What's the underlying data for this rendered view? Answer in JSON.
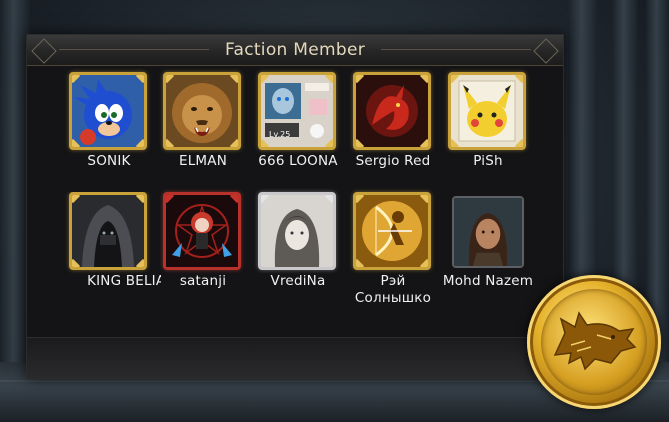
{
  "panel": {
    "title": "Faction Member"
  },
  "members": [
    {
      "name": "SONIK",
      "frame": "gold",
      "art": "sonic-icon"
    },
    {
      "name": "ELMAN",
      "frame": "gold",
      "art": "lion-icon"
    },
    {
      "name": "666 LOONA",
      "frame": "gold",
      "art": "white-walker-icon",
      "level": "Lv.25"
    },
    {
      "name": "Sergio Red",
      "frame": "gold",
      "art": "red-dragon-icon"
    },
    {
      "name": "PiSh",
      "frame": "gold",
      "art": "pikachu-icon"
    },
    {
      "name": "KING BELIAL",
      "frame": "gold",
      "art": "hooded-figure-icon"
    },
    {
      "name": "satanji",
      "frame": "red",
      "art": "red-hair-girl-icon"
    },
    {
      "name": "VrediNa",
      "frame": "silver",
      "art": "woman-portrait-icon"
    },
    {
      "name": "Рэй Солнышко",
      "frame": "gold",
      "art": "archer-icon"
    },
    {
      "name": "Mohd Nazem",
      "frame": "plain",
      "art": "warrior-woman-icon"
    }
  ],
  "faction_emblem": {
    "icon": "direwolf-icon",
    "color": "#d9a92a"
  },
  "colors": {
    "gold": "#c9a23a",
    "title": "#e3d8bc",
    "panel": "#141416"
  }
}
